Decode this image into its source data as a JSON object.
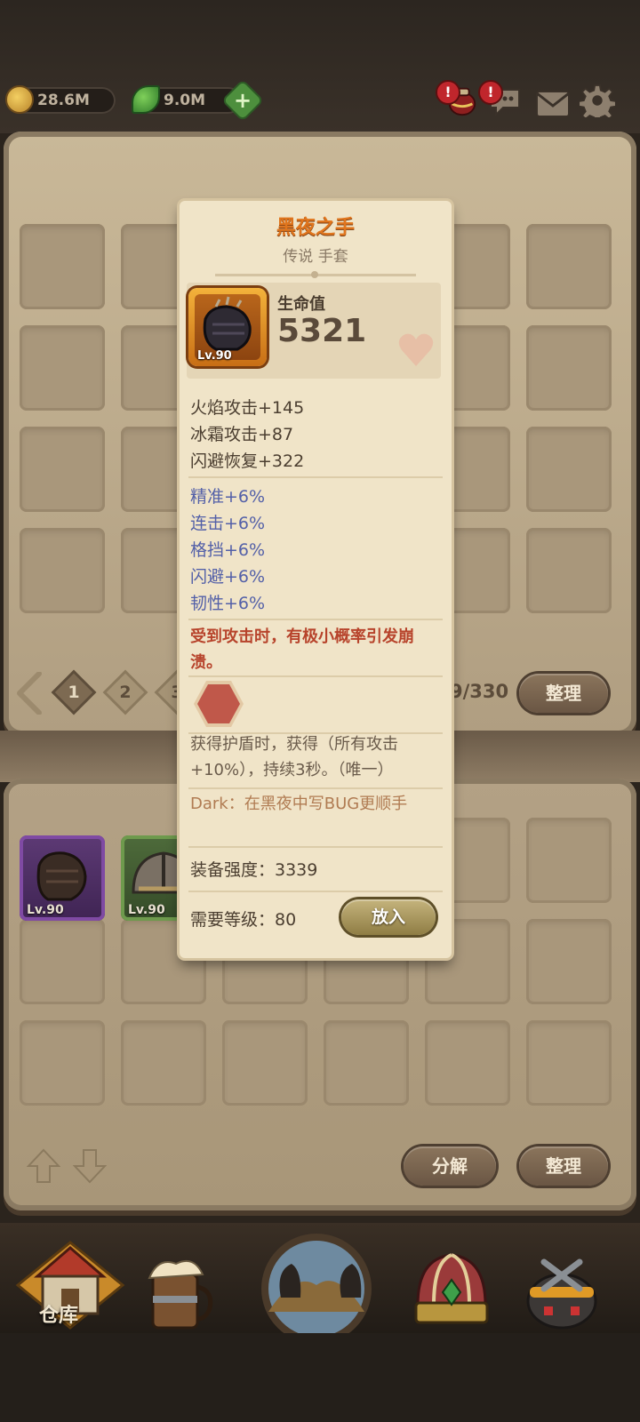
{
  "resources": {
    "gold": "28.6M",
    "leaf": "9.0M",
    "plus": "+"
  },
  "alerts": {
    "a1": "!",
    "a2": "!"
  },
  "pager": {
    "pages": [
      "1",
      "2",
      "3"
    ],
    "counter": "9/330",
    "sort_label": "整理"
  },
  "bottom_actions": {
    "decompose_label": "分解",
    "sort_label": "整理"
  },
  "inventory_items": [
    {
      "level": "Lv.90"
    },
    {
      "level": "Lv.90"
    }
  ],
  "nav": {
    "warehouse_label": "仓库"
  },
  "tooltip": {
    "name": "黑夜之手",
    "rarity_type": "传说 手套",
    "item_level": "Lv.90",
    "main_stat_label": "生命值",
    "main_stat_value": "5321",
    "attributes": [
      "火焰攻击+145",
      "冰霜攻击+87",
      "闪避恢复+322"
    ],
    "sub_attributes": [
      "精准+6%",
      "连击+6%",
      "格挡+6%",
      "闪避+6%",
      "韧性+6%"
    ],
    "special_effect": "受到攻击时，有极小概率引发崩溃。",
    "socket_effect": "获得护盾时，获得（所有攻击+10%），持续3秒。（唯一）",
    "flavor": "Dark：在黑夜中写BUG更顺手",
    "power": "装备强度：3339",
    "required_level": "需要等级：80",
    "put_label": "放入"
  },
  "colors": {
    "title": "#e0751d",
    "sub_attr": "#5360a8",
    "special": "#b7432b",
    "flavor": "#b07b52"
  }
}
